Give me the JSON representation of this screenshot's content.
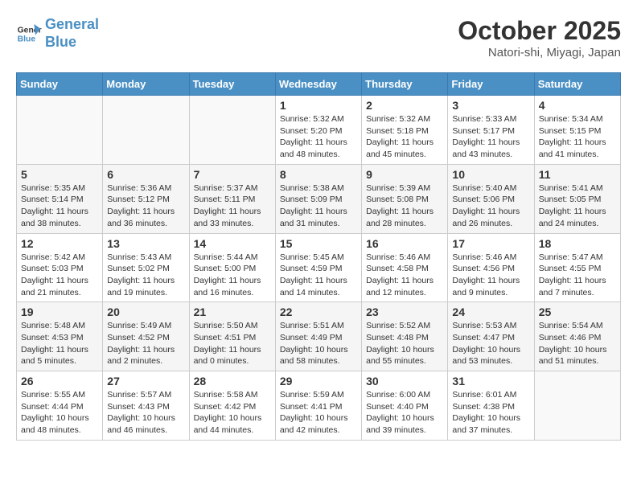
{
  "logo": {
    "line1": "General",
    "line2": "Blue"
  },
  "title": "October 2025",
  "subtitle": "Natori-shi, Miyagi, Japan",
  "days_of_week": [
    "Sunday",
    "Monday",
    "Tuesday",
    "Wednesday",
    "Thursday",
    "Friday",
    "Saturday"
  ],
  "weeks": [
    [
      {
        "day": "",
        "info": ""
      },
      {
        "day": "",
        "info": ""
      },
      {
        "day": "",
        "info": ""
      },
      {
        "day": "1",
        "info": "Sunrise: 5:32 AM\nSunset: 5:20 PM\nDaylight: 11 hours\nand 48 minutes."
      },
      {
        "day": "2",
        "info": "Sunrise: 5:32 AM\nSunset: 5:18 PM\nDaylight: 11 hours\nand 45 minutes."
      },
      {
        "day": "3",
        "info": "Sunrise: 5:33 AM\nSunset: 5:17 PM\nDaylight: 11 hours\nand 43 minutes."
      },
      {
        "day": "4",
        "info": "Sunrise: 5:34 AM\nSunset: 5:15 PM\nDaylight: 11 hours\nand 41 minutes."
      }
    ],
    [
      {
        "day": "5",
        "info": "Sunrise: 5:35 AM\nSunset: 5:14 PM\nDaylight: 11 hours\nand 38 minutes."
      },
      {
        "day": "6",
        "info": "Sunrise: 5:36 AM\nSunset: 5:12 PM\nDaylight: 11 hours\nand 36 minutes."
      },
      {
        "day": "7",
        "info": "Sunrise: 5:37 AM\nSunset: 5:11 PM\nDaylight: 11 hours\nand 33 minutes."
      },
      {
        "day": "8",
        "info": "Sunrise: 5:38 AM\nSunset: 5:09 PM\nDaylight: 11 hours\nand 31 minutes."
      },
      {
        "day": "9",
        "info": "Sunrise: 5:39 AM\nSunset: 5:08 PM\nDaylight: 11 hours\nand 28 minutes."
      },
      {
        "day": "10",
        "info": "Sunrise: 5:40 AM\nSunset: 5:06 PM\nDaylight: 11 hours\nand 26 minutes."
      },
      {
        "day": "11",
        "info": "Sunrise: 5:41 AM\nSunset: 5:05 PM\nDaylight: 11 hours\nand 24 minutes."
      }
    ],
    [
      {
        "day": "12",
        "info": "Sunrise: 5:42 AM\nSunset: 5:03 PM\nDaylight: 11 hours\nand 21 minutes."
      },
      {
        "day": "13",
        "info": "Sunrise: 5:43 AM\nSunset: 5:02 PM\nDaylight: 11 hours\nand 19 minutes."
      },
      {
        "day": "14",
        "info": "Sunrise: 5:44 AM\nSunset: 5:00 PM\nDaylight: 11 hours\nand 16 minutes."
      },
      {
        "day": "15",
        "info": "Sunrise: 5:45 AM\nSunset: 4:59 PM\nDaylight: 11 hours\nand 14 minutes."
      },
      {
        "day": "16",
        "info": "Sunrise: 5:46 AM\nSunset: 4:58 PM\nDaylight: 11 hours\nand 12 minutes."
      },
      {
        "day": "17",
        "info": "Sunrise: 5:46 AM\nSunset: 4:56 PM\nDaylight: 11 hours\nand 9 minutes."
      },
      {
        "day": "18",
        "info": "Sunrise: 5:47 AM\nSunset: 4:55 PM\nDaylight: 11 hours\nand 7 minutes."
      }
    ],
    [
      {
        "day": "19",
        "info": "Sunrise: 5:48 AM\nSunset: 4:53 PM\nDaylight: 11 hours\nand 5 minutes."
      },
      {
        "day": "20",
        "info": "Sunrise: 5:49 AM\nSunset: 4:52 PM\nDaylight: 11 hours\nand 2 minutes."
      },
      {
        "day": "21",
        "info": "Sunrise: 5:50 AM\nSunset: 4:51 PM\nDaylight: 11 hours\nand 0 minutes."
      },
      {
        "day": "22",
        "info": "Sunrise: 5:51 AM\nSunset: 4:49 PM\nDaylight: 10 hours\nand 58 minutes."
      },
      {
        "day": "23",
        "info": "Sunrise: 5:52 AM\nSunset: 4:48 PM\nDaylight: 10 hours\nand 55 minutes."
      },
      {
        "day": "24",
        "info": "Sunrise: 5:53 AM\nSunset: 4:47 PM\nDaylight: 10 hours\nand 53 minutes."
      },
      {
        "day": "25",
        "info": "Sunrise: 5:54 AM\nSunset: 4:46 PM\nDaylight: 10 hours\nand 51 minutes."
      }
    ],
    [
      {
        "day": "26",
        "info": "Sunrise: 5:55 AM\nSunset: 4:44 PM\nDaylight: 10 hours\nand 48 minutes."
      },
      {
        "day": "27",
        "info": "Sunrise: 5:57 AM\nSunset: 4:43 PM\nDaylight: 10 hours\nand 46 minutes."
      },
      {
        "day": "28",
        "info": "Sunrise: 5:58 AM\nSunset: 4:42 PM\nDaylight: 10 hours\nand 44 minutes."
      },
      {
        "day": "29",
        "info": "Sunrise: 5:59 AM\nSunset: 4:41 PM\nDaylight: 10 hours\nand 42 minutes."
      },
      {
        "day": "30",
        "info": "Sunrise: 6:00 AM\nSunset: 4:40 PM\nDaylight: 10 hours\nand 39 minutes."
      },
      {
        "day": "31",
        "info": "Sunrise: 6:01 AM\nSunset: 4:38 PM\nDaylight: 10 hours\nand 37 minutes."
      },
      {
        "day": "",
        "info": ""
      }
    ]
  ]
}
